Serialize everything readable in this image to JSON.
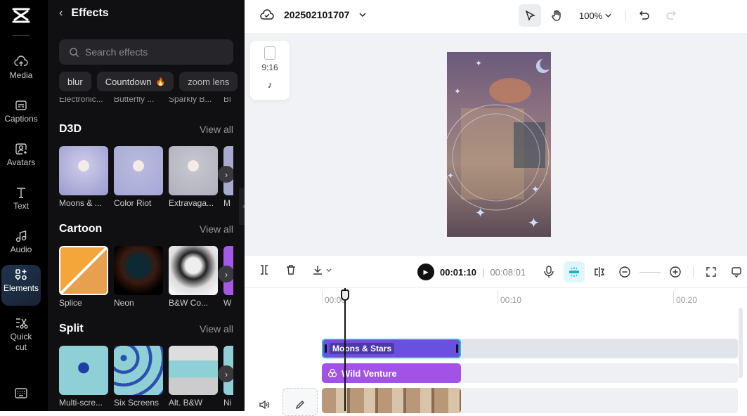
{
  "rail": {
    "items": [
      {
        "label": "Media",
        "icon": "cloud-upload-icon"
      },
      {
        "label": "Captions",
        "icon": "captions-icon"
      },
      {
        "label": "Avatars",
        "icon": "avatar-icon"
      },
      {
        "label": "Text",
        "icon": "text-icon"
      },
      {
        "label": "Audio",
        "icon": "music-note-icon"
      },
      {
        "label": "Elements",
        "icon": "elements-icon",
        "active": true
      },
      {
        "label": "Quick cut",
        "icon": "quick-cut-icon"
      }
    ],
    "keyboard_icon": "keyboard-icon"
  },
  "panel": {
    "title": "Effects",
    "search_placeholder": "Search effects",
    "chips": [
      "blur",
      "Countdown",
      "zoom lens"
    ],
    "hot_icon": "🔥",
    "previous_row_labels": [
      "Electronic...",
      "Butterfly ...",
      "Sparkly B...",
      "Bl"
    ],
    "view_all": "View all",
    "sections": [
      {
        "title": "D3D",
        "items": [
          "Moons & ...",
          "Color Riot",
          "Extravaga...",
          "M"
        ]
      },
      {
        "title": "Cartoon",
        "items": [
          "Splice",
          "Neon",
          "B&W Co...",
          "W"
        ]
      },
      {
        "title": "Split",
        "items": [
          "Multi-scre...",
          "Six Screens",
          "Alt. B&W",
          "Ni"
        ]
      }
    ]
  },
  "topbar": {
    "project_name": "202502101707",
    "zoom": "100%"
  },
  "canvas": {
    "ratio": "9:16",
    "platform_icon": "tiktok-icon"
  },
  "playback": {
    "current": "00:01:10",
    "separator": "|",
    "duration": "00:08:01"
  },
  "ruler": {
    "labels": [
      "00:00",
      "00:10",
      "00:20"
    ]
  },
  "tracks": {
    "effect_clip": "Moons & Stars",
    "filter_clip": "Wild Venture"
  },
  "colors": {
    "effect_clip": "#6a4fe0",
    "filter_clip": "#a252e6",
    "selection": "#19c2d9"
  }
}
